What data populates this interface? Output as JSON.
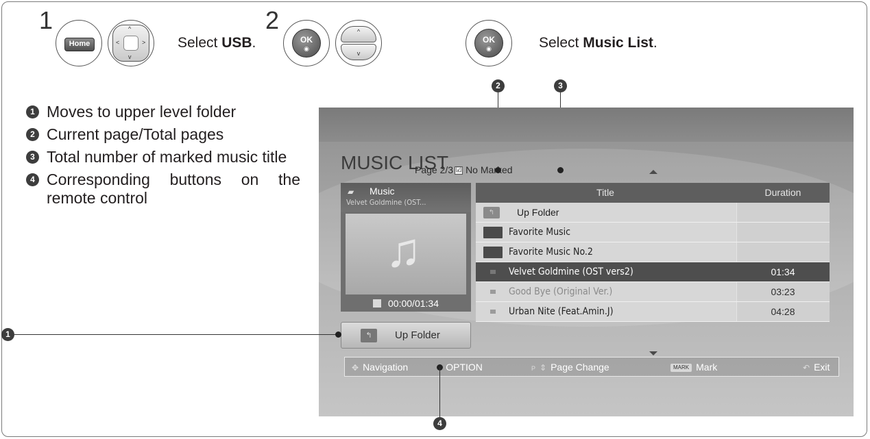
{
  "steps": [
    {
      "number": "1",
      "text_before": "Select ",
      "bold": "USB",
      "text_after": "."
    },
    {
      "number": "2",
      "text_before": "Select ",
      "bold": "Music List",
      "text_after": "."
    }
  ],
  "buttons": {
    "home": "Home",
    "ok": "OK",
    "ok_dot": "◉"
  },
  "legend": [
    {
      "num": "1",
      "text": "Moves to upper level folder"
    },
    {
      "num": "2",
      "text": "Current page/Total pages"
    },
    {
      "num": "3",
      "text": "Total number of marked music title"
    },
    {
      "num": "4",
      "text": "Corresponding buttons on the remote control"
    }
  ],
  "callouts": [
    "1",
    "2",
    "3",
    "4"
  ],
  "screen": {
    "title": "MUSIC LIST",
    "page": "Page 2/3",
    "checkbox": "☑",
    "marked": "No Marked",
    "panel": {
      "label": "Music",
      "track": "Velvet Goldmine (OST...",
      "time": "00:00/01:34"
    },
    "upfolder_button": "Up Folder",
    "columns": {
      "title": "Title",
      "duration": "Duration"
    },
    "rows": [
      {
        "title": "Up Folder",
        "duration": "",
        "kind": "upfolder"
      },
      {
        "title": "Favorite Music",
        "duration": "",
        "kind": "folder"
      },
      {
        "title": "Favorite Music No.2",
        "duration": "",
        "kind": "folder"
      },
      {
        "title": "Velvet Goldmine (OST vers2)",
        "duration": "01:34",
        "kind": "selected"
      },
      {
        "title": "Good Bye (Original Ver.)",
        "duration": "03:23",
        "kind": "dim"
      },
      {
        "title": "Urban Nite (Feat.Amin.J)",
        "duration": "04:28",
        "kind": "file"
      }
    ],
    "navbar": {
      "navigation": "Navigation",
      "option": "OPTION",
      "p_icon": "P",
      "page_change": "Page Change",
      "mark_key": "MARK",
      "mark": "Mark",
      "exit": "Exit"
    }
  }
}
